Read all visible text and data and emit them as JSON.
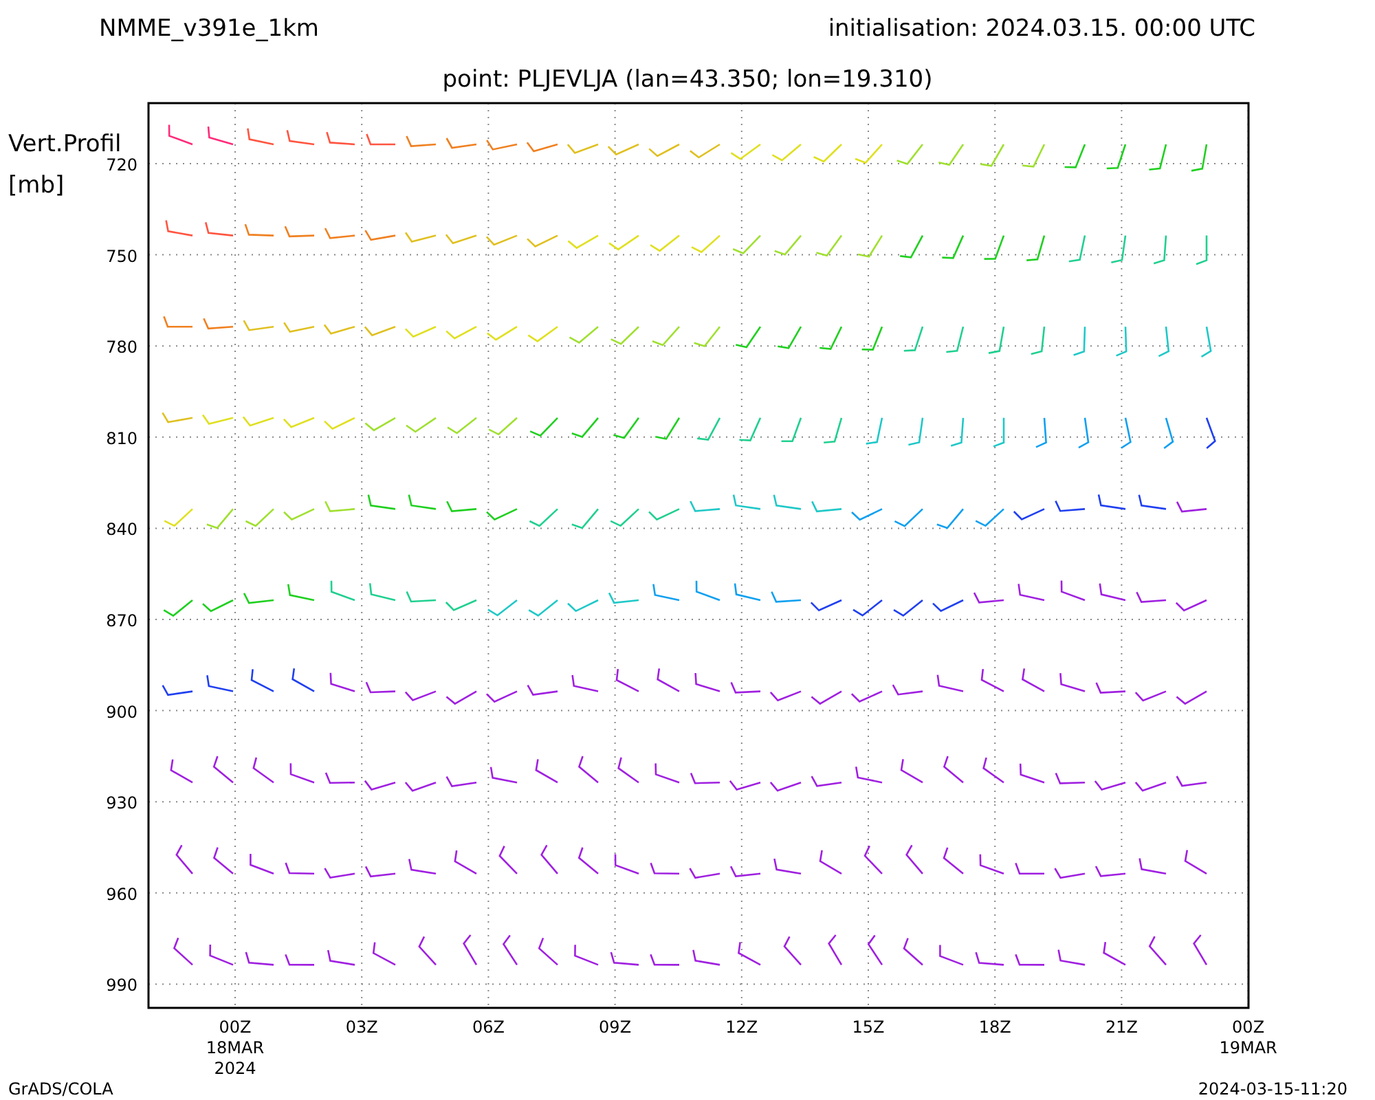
{
  "header": {
    "model": "NMME_v391e_1km",
    "initialisation": "initialisation: 2024.03.15. 00:00 UTC"
  },
  "subtitle": "point: PLJEVLJA (lan=43.350; lon=19.310)",
  "y_axis": {
    "title": "Vert.Profil",
    "unit": "[mb]",
    "ticks": [
      "720",
      "750",
      "780",
      "810",
      "840",
      "870",
      "900",
      "930",
      "960",
      "990"
    ]
  },
  "x_axis": {
    "ticks": [
      {
        "label": "00Z",
        "date": "18MAR",
        "year": "2024"
      },
      {
        "label": "03Z"
      },
      {
        "label": "06Z"
      },
      {
        "label": "09Z"
      },
      {
        "label": "12Z"
      },
      {
        "label": "15Z"
      },
      {
        "label": "18Z"
      },
      {
        "label": "21Z"
      },
      {
        "label": "00Z",
        "date": "19MAR"
      }
    ]
  },
  "footer": {
    "left": "GrADS/COLA",
    "right": "2024-03-15-11:20"
  }
}
